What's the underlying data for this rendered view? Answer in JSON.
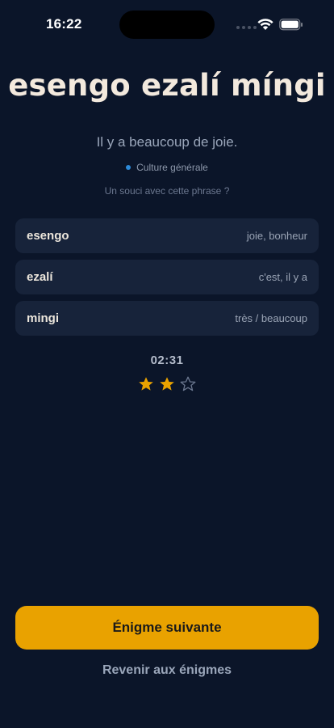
{
  "status_bar": {
    "time": "16:22",
    "icons": [
      "signal-dots-icon",
      "wifi-icon",
      "battery-icon"
    ]
  },
  "puzzle": {
    "title": "esengo ezalí míngi",
    "translation": "Il y a beaucoup de joie.",
    "category": "Culture générale",
    "report_link": "Un souci avec cette phrase ?"
  },
  "words": [
    {
      "word": "esengo",
      "meaning": "joie, bonheur"
    },
    {
      "word": "ezalí",
      "meaning": "c'est, il y a"
    },
    {
      "word": "mingi",
      "meaning": "très / beaucoup"
    }
  ],
  "result": {
    "time": "02:31",
    "stars_earned": 2,
    "stars_total": 3
  },
  "actions": {
    "next_label": "Énigme suivante",
    "back_label": "Revenir aux énigmes"
  },
  "colors": {
    "background": "#0b1529",
    "card": "#17233a",
    "accent": "#e9a200",
    "category_dot": "#2d8bd9",
    "star_filled": "#e9a200",
    "star_empty": "#6c7890"
  }
}
